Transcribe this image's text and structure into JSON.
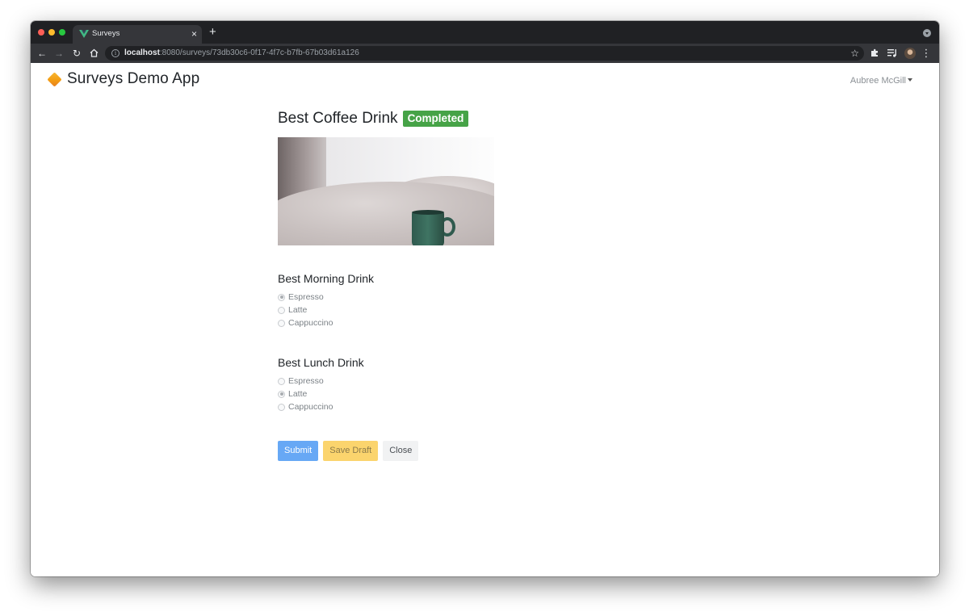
{
  "browser": {
    "tab_title": "Surveys",
    "tab_close": "×",
    "new_tab": "+",
    "url_host": "localhost",
    "url_rest": ":8080/surveys/73db30c6-0f17-4f7c-b7fb-67b03d61a126"
  },
  "navbar": {
    "brand": "Surveys Demo App",
    "user": "Aubree McGill"
  },
  "survey": {
    "title": "Best Coffee Drink",
    "status": "Completed",
    "questions": [
      {
        "title": "Best Morning Drink",
        "options": [
          {
            "label": "Espresso",
            "checked": true
          },
          {
            "label": "Latte",
            "checked": false
          },
          {
            "label": "Cappuccino",
            "checked": false
          }
        ]
      },
      {
        "title": "Best Lunch Drink",
        "options": [
          {
            "label": "Espresso",
            "checked": false
          },
          {
            "label": "Latte",
            "checked": true
          },
          {
            "label": "Cappuccino",
            "checked": false
          }
        ]
      }
    ]
  },
  "actions": {
    "submit": "Submit",
    "save_draft": "Save Draft",
    "close": "Close"
  },
  "colors": {
    "badge_green": "#46a347",
    "submit_blue": "#67a8f5",
    "draft_yellow": "#fbd46d",
    "brand_orange": "#f39c12"
  }
}
